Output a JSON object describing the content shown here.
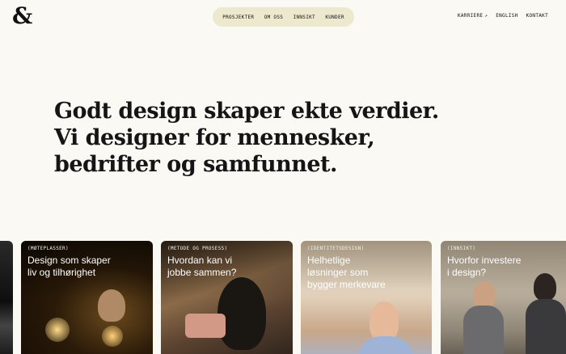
{
  "brand": {
    "logo": "&"
  },
  "nav": {
    "items": [
      {
        "label": "PROSJEKTER"
      },
      {
        "label": "OM OSS"
      },
      {
        "label": "INNSIKT"
      },
      {
        "label": "KUNDER"
      }
    ]
  },
  "right_nav": {
    "karriere": "KARRIERE",
    "karriere_arrow": "↗",
    "english": "ENGLISH",
    "kontakt": "KONTAKT"
  },
  "hero": {
    "lines": [
      "Godt design skaper ekte verdier.",
      "Vi designer for mennesker,",
      "bedrifter og samfunnet."
    ]
  },
  "cards": [
    {
      "tag": "(MØTEPLASSER)",
      "title_lines": [
        "Design som skaper",
        "liv og tilhørighet"
      ]
    },
    {
      "tag": "(METODE OG PROSESS)",
      "title_lines": [
        "Hvordan kan vi",
        "jobbe sammen?"
      ]
    },
    {
      "tag": "(IDENTITETSDESIGN)",
      "title_lines": [
        "Helhetlige",
        "løsninger som",
        "bygger merkevare"
      ]
    },
    {
      "tag": "(INNSIKT)",
      "title_lines": [
        "Hvorfor investere",
        "i design?"
      ]
    }
  ]
}
